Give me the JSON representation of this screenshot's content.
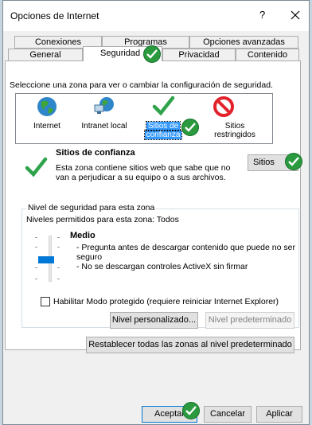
{
  "window": {
    "title": "Opciones de Internet",
    "help": "?"
  },
  "tabs": {
    "row1": [
      "Conexiones",
      "Programas",
      "Opciones avanzadas"
    ],
    "row2": [
      "General",
      "Seguridad",
      "Privacidad",
      "Contenido"
    ],
    "active": "Seguridad"
  },
  "security": {
    "instruction": "Seleccione una zona para ver o cambiar la configuración de seguridad.",
    "zones": [
      {
        "label": "Internet",
        "icon": "globe-icon"
      },
      {
        "label": "Intranet local",
        "icon": "intranet-icon"
      },
      {
        "label": "Sitios de confianza",
        "label_line1": "Sitios de",
        "label_line2": "confianza",
        "icon": "trusted-check-icon",
        "selected": true
      },
      {
        "label": "Sitios restringidos",
        "label_line1": "Sitios",
        "label_line2": "restringidos",
        "icon": "restricted-icon"
      }
    ],
    "zone_info": {
      "title": "Sitios de confianza",
      "description_line1": "Esta zona contiene sitios web que sabe que no",
      "description_line2": "van a perjudicar a su equipo o a sus archivos."
    },
    "sites_button": "Sitios",
    "level_group": {
      "legend": "Nivel de seguridad para esta zona",
      "allowed": "Niveles permitidos para esta zona: Todos",
      "level_name": "Medio",
      "bullet1_line1": "- Pregunta antes de descargar contenido que puede no ser",
      "bullet1_line2": "seguro",
      "bullet2": "- No se descargan controles ActiveX sin firmar",
      "protected_mode": "Habilitar Modo protegido (requiere reiniciar Internet Explorer)",
      "protected_mode_checked": false,
      "custom_button": "Nivel personalizado...",
      "default_button": "Nivel predeterminado"
    },
    "reset_all_button": "Restablecer todas las zonas al nivel predeterminado"
  },
  "footer": {
    "ok": "Aceptar",
    "cancel": "Cancelar",
    "apply": "Aplicar"
  },
  "colors": {
    "accent": "#0078d7",
    "selection": "#3399ff",
    "check_green": "#2b9a3e",
    "restricted_red": "#e3232c"
  }
}
